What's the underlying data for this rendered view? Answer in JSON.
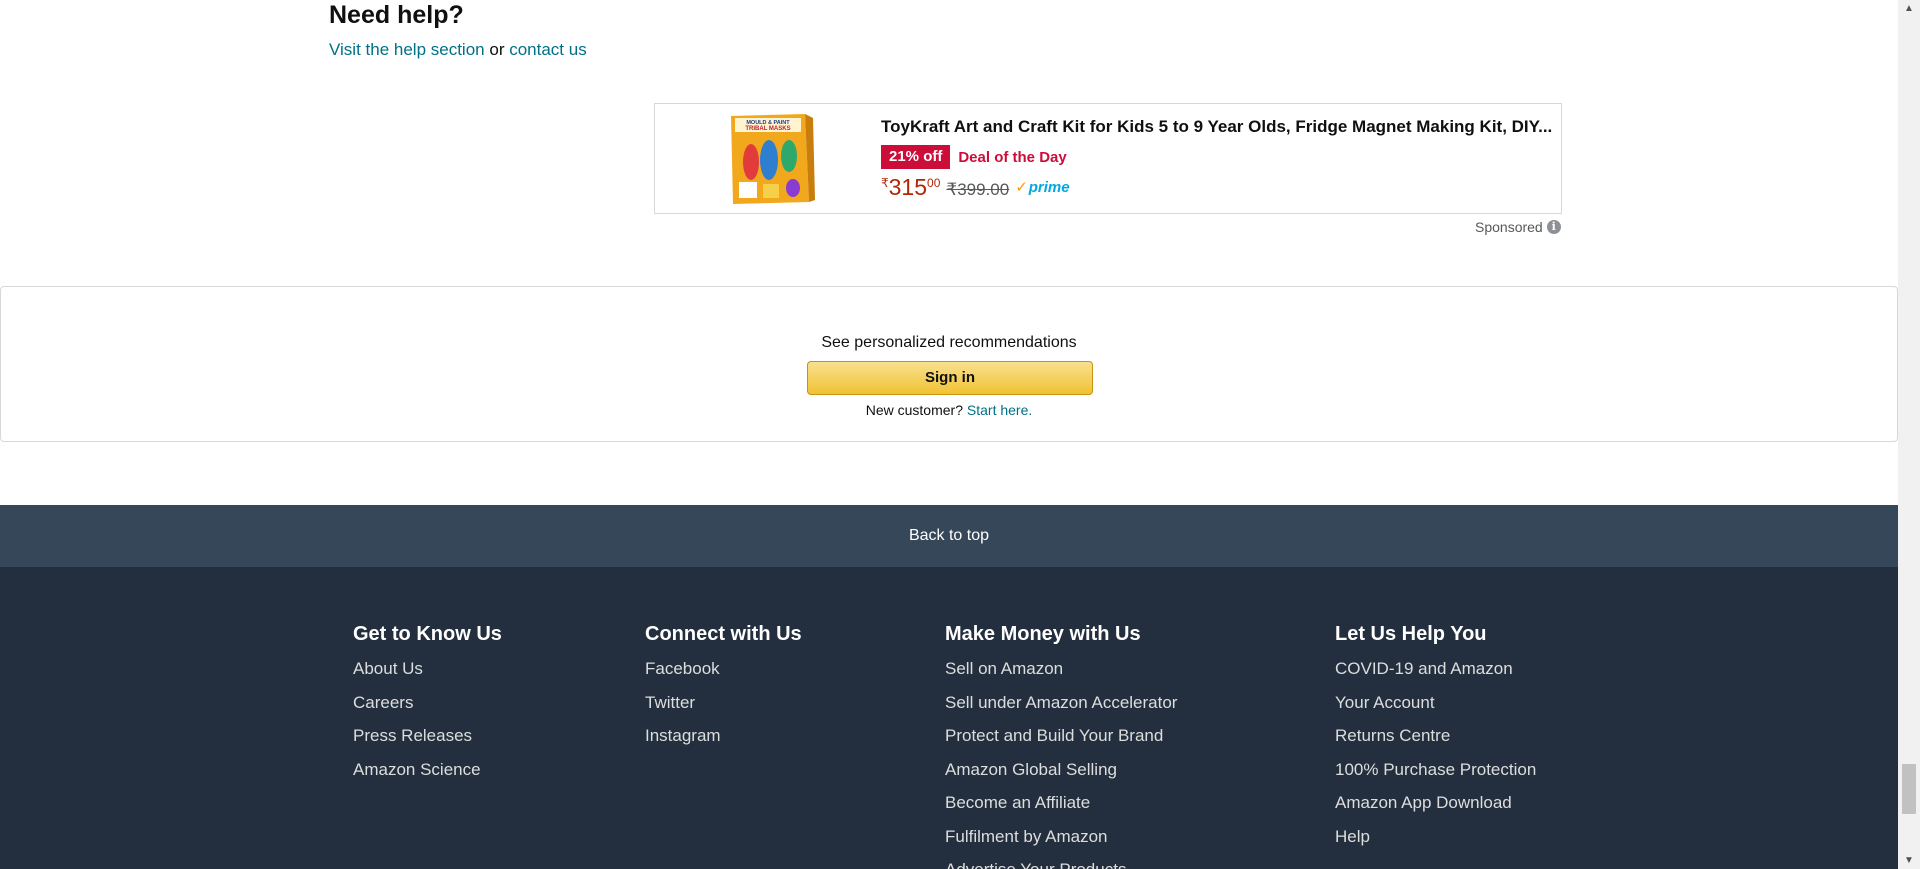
{
  "help": {
    "title": "Need help?",
    "link_help": "Visit the help section",
    "or_text": "or",
    "link_contact": "contact us"
  },
  "ad": {
    "thumb_text_1": "MOULD & PAINT",
    "thumb_text_2": "TRIBAL MASKS",
    "title": "ToyKraft Art and Craft Kit for Kids 5 to 9 Year Olds, Fridge Magnet Making Kit, DIY...",
    "discount": "21% off",
    "deal": "Deal of the Day",
    "price_symbol": "₹",
    "price_whole": "315",
    "price_fraction": "00",
    "old_price": "₹399.00",
    "prime_check": "✓",
    "prime_word": "prime",
    "sponsored": "Sponsored",
    "info_icon": "i"
  },
  "signin": {
    "recommend_text": "See personalized recommendations",
    "button_label": "Sign in",
    "new_customer": "New customer?",
    "start_here": "Start here."
  },
  "back_to_top": "Back to top",
  "footer": {
    "columns": [
      {
        "title": "Get to Know Us",
        "items": [
          "About Us",
          "Careers",
          "Press Releases",
          "Amazon Science"
        ]
      },
      {
        "title": "Connect with Us",
        "items": [
          "Facebook",
          "Twitter",
          "Instagram"
        ]
      },
      {
        "title": "Make Money with Us",
        "items": [
          "Sell on Amazon",
          "Sell under Amazon Accelerator",
          "Protect and Build Your Brand",
          "Amazon Global Selling",
          "Become an Affiliate",
          "Fulfilment by Amazon",
          "Advertise Your Products"
        ]
      },
      {
        "title": "Let Us Help You",
        "items": [
          "COVID-19 and Amazon",
          "Your Account",
          "Returns Centre",
          "100% Purchase Protection",
          "Amazon App Download",
          "Help"
        ]
      }
    ]
  },
  "colors": {
    "link": "#007185",
    "deal_red": "#cc0c39",
    "price_red": "#b12704",
    "back_to_top_bg": "#37475a",
    "footer_bg": "#232f3e",
    "signin_button": "#f1c232"
  }
}
